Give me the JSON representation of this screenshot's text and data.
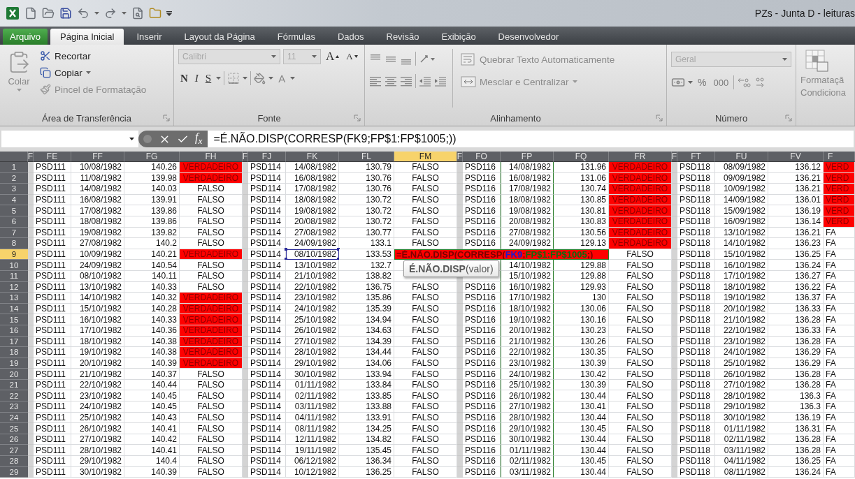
{
  "title_bar": {
    "title": "PZs - Junta D - leituras"
  },
  "ribbon_tabs": [
    {
      "label": "Arquivo",
      "kind": "file",
      "selected": false
    },
    {
      "label": "Página Inicial",
      "kind": "tab",
      "selected": true
    },
    {
      "label": "Inserir",
      "kind": "tab",
      "selected": false
    },
    {
      "label": "Layout da Página",
      "kind": "tab",
      "selected": false
    },
    {
      "label": "Fórmulas",
      "kind": "tab",
      "selected": false
    },
    {
      "label": "Dados",
      "kind": "tab",
      "selected": false
    },
    {
      "label": "Revisão",
      "kind": "tab",
      "selected": false
    },
    {
      "label": "Exibição",
      "kind": "tab",
      "selected": false
    },
    {
      "label": "Desenvolvedor",
      "kind": "tab",
      "selected": false
    }
  ],
  "clipboard": {
    "label": "Área de Transferência",
    "paste": {
      "label": "Colar",
      "disabled": true
    },
    "items": [
      {
        "label": "Recortar",
        "kind": "cut",
        "disabled": false,
        "menu": false
      },
      {
        "label": "Copiar",
        "kind": "copy",
        "disabled": false,
        "menu": true
      },
      {
        "label": "Pincel de Formatação",
        "kind": "painter",
        "disabled": true,
        "menu": false
      }
    ]
  },
  "font": {
    "label": "Fonte",
    "font_name": "Calibri",
    "font_size": "11",
    "grow": "A",
    "shrink": "A",
    "styles": [
      {
        "label": "N",
        "kind": "bold"
      },
      {
        "label": "I",
        "kind": "italic"
      },
      {
        "label": "S",
        "kind": "underline"
      }
    ],
    "font_color": "A"
  },
  "alignment": {
    "label": "Alinhamento",
    "wrap": "Quebrar Texto Automaticamente",
    "merge": "Mesclar e Centralizar"
  },
  "number": {
    "label": "Número",
    "format": "Geral",
    "percent": "%",
    "thousands": "000"
  },
  "styles": {
    "conditional": [
      "Formataçã",
      "Condiciona"
    ]
  },
  "formula_bar": {
    "function": "f$_{x}$",
    "formula": "=É.NÃO.DISP(CORRESP(FK9;FP$1:FP$1005;))"
  },
  "grid": {
    "columns": [
      {
        "label": "F",
        "kind": "gap",
        "selected": false,
        "range_ref": false
      },
      {
        "label": "FE",
        "kind": "code",
        "selected": false,
        "range_ref": false
      },
      {
        "label": "FF",
        "kind": "date",
        "selected": false,
        "range_ref": false
      },
      {
        "label": "FG",
        "kind": "number",
        "selected": false,
        "range_ref": false
      },
      {
        "label": "FH",
        "kind": "flag",
        "selected": false,
        "range_ref": false
      },
      {
        "label": "F",
        "kind": "gap",
        "selected": false,
        "range_ref": false
      },
      {
        "label": "FJ",
        "kind": "code",
        "selected": false,
        "range_ref": false
      },
      {
        "label": "FK",
        "kind": "date",
        "selected": false,
        "range_ref": false
      },
      {
        "label": "FL",
        "kind": "number",
        "selected": false,
        "range_ref": false
      },
      {
        "label": "FM",
        "kind": "flag",
        "selected": true,
        "range_ref": false
      },
      {
        "label": "F",
        "kind": "gap",
        "selected": false,
        "range_ref": false
      },
      {
        "label": "FO",
        "kind": "code",
        "selected": false,
        "range_ref": false
      },
      {
        "label": "FP",
        "kind": "date",
        "selected": false,
        "range_ref": true
      },
      {
        "label": "FQ",
        "kind": "number",
        "selected": false,
        "range_ref": false
      },
      {
        "label": "FR",
        "kind": "flag",
        "selected": false,
        "range_ref": false
      },
      {
        "label": "F",
        "kind": "gap",
        "selected": false,
        "range_ref": false
      },
      {
        "label": "FT",
        "kind": "code",
        "selected": false,
        "range_ref": false
      },
      {
        "label": "FU",
        "kind": "date",
        "selected": false,
        "range_ref": false
      },
      {
        "label": "FV",
        "kind": "number",
        "selected": false,
        "range_ref": false
      },
      {
        "label": "F",
        "kind": "cut",
        "selected": false,
        "range_ref": false
      }
    ],
    "rows": [
      {
        "number": "1",
        "selected": false,
        "cells": [
          "",
          "PSD111",
          "10/08/1982",
          "140.26",
          "VERDADEIRO",
          "",
          "PSD114",
          "14/08/1982",
          "130.79",
          "FALSO",
          "",
          "PSD116",
          "14/08/1982",
          "131.96",
          "VERDADEIRO",
          "",
          "PSD118",
          "08/09/1982",
          "136.12",
          "VERD"
        ],
        "highlighted": [
          true,
          false,
          true,
          true
        ]
      },
      {
        "number": "2",
        "selected": false,
        "cells": [
          "",
          "PSD111",
          "11/08/1982",
          "139.98",
          "VERDADEIRO",
          "",
          "PSD114",
          "16/08/1982",
          "130.76",
          "FALSO",
          "",
          "PSD116",
          "16/08/1982",
          "131.06",
          "VERDADEIRO",
          "",
          "PSD118",
          "09/09/1982",
          "136.21",
          "VERD"
        ],
        "highlighted": [
          true,
          false,
          true,
          true
        ]
      },
      {
        "number": "3",
        "selected": false,
        "cells": [
          "",
          "PSD111",
          "14/08/1982",
          "140.03",
          "FALSO",
          "",
          "PSD114",
          "17/08/1982",
          "130.76",
          "FALSO",
          "",
          "PSD116",
          "17/08/1982",
          "130.74",
          "VERDADEIRO",
          "",
          "PSD118",
          "10/09/1982",
          "136.21",
          "VERD"
        ],
        "highlighted": [
          false,
          false,
          true,
          true
        ]
      },
      {
        "number": "4",
        "selected": false,
        "cells": [
          "",
          "PSD111",
          "16/08/1982",
          "139.91",
          "FALSO",
          "",
          "PSD114",
          "18/08/1982",
          "130.72",
          "FALSO",
          "",
          "PSD116",
          "18/08/1982",
          "130.85",
          "VERDADEIRO",
          "",
          "PSD118",
          "14/09/1982",
          "136.01",
          "VERD"
        ],
        "highlighted": [
          false,
          false,
          true,
          true
        ]
      },
      {
        "number": "5",
        "selected": false,
        "cells": [
          "",
          "PSD111",
          "17/08/1982",
          "139.86",
          "FALSO",
          "",
          "PSD114",
          "19/08/1982",
          "130.72",
          "FALSO",
          "",
          "PSD116",
          "19/08/1982",
          "130.81",
          "VERDADEIRO",
          "",
          "PSD118",
          "15/09/1982",
          "136.19",
          "VERD"
        ],
        "highlighted": [
          false,
          false,
          true,
          true
        ]
      },
      {
        "number": "6",
        "selected": false,
        "cells": [
          "",
          "PSD111",
          "18/08/1982",
          "139.86",
          "FALSO",
          "",
          "PSD114",
          "20/08/1982",
          "130.72",
          "FALSO",
          "",
          "PSD116",
          "20/08/1982",
          "130.83",
          "VERDADEIRO",
          "",
          "PSD118",
          "16/09/1982",
          "136.14",
          "VERD"
        ],
        "highlighted": [
          false,
          false,
          true,
          true
        ]
      },
      {
        "number": "7",
        "selected": false,
        "cells": [
          "",
          "PSD111",
          "19/08/1982",
          "139.82",
          "FALSO",
          "",
          "PSD114",
          "27/08/1982",
          "130.77",
          "FALSO",
          "",
          "PSD116",
          "27/08/1982",
          "130.56",
          "VERDADEIRO",
          "",
          "PSD118",
          "13/10/1982",
          "136.21",
          "FA"
        ],
        "highlighted": [
          false,
          false,
          true,
          false
        ]
      },
      {
        "number": "8",
        "selected": false,
        "cells": [
          "",
          "PSD111",
          "27/08/1982",
          "140.2",
          "FALSO",
          "",
          "PSD114",
          "24/09/1982",
          "133.1",
          "FALSO",
          "",
          "PSD116",
          "24/09/1982",
          "129.13",
          "VERDADEIRO",
          "",
          "PSD118",
          "14/10/1982",
          "136.23",
          "FA"
        ],
        "highlighted": [
          false,
          false,
          true,
          false
        ]
      },
      {
        "number": "9",
        "selected": true,
        "cells": [
          "",
          "PSD111",
          "10/09/1982",
          "140.21",
          "VERDADEIRO",
          "",
          "PSD114",
          {
            "text": "08/10/1982",
            "referenced": true
          },
          "133.53",
          null,
          null,
          null,
          null,
          null,
          "FALSO",
          "",
          "PSD118",
          "15/10/1982",
          "136.25",
          "FA"
        ],
        "highlighted": [
          true,
          true,
          false,
          false
        ],
        "formula": [
          {
            "text": "=É.NÃO.DISP(CORRESP(",
            "kind": "text"
          },
          {
            "text": "FK9",
            "kind": "cell_ref"
          },
          {
            "text": ";",
            "kind": "text"
          },
          {
            "text": "FP$1:FP$1005",
            "kind": "range_ref"
          },
          {
            "text": ";)",
            "kind": "text"
          }
        ]
      },
      {
        "number": "10",
        "selected": false,
        "cells": [
          "",
          "PSD111",
          "24/09/1982",
          "140.54",
          "FALSO",
          "",
          "PSD114",
          "13/10/1982",
          "132.7",
          null,
          "",
          null,
          "14/10/1982",
          "129.88",
          "FALSO",
          "",
          "PSD118",
          "16/10/1982",
          "136.24",
          "FA"
        ],
        "highlighted": [
          false,
          false,
          false,
          false
        ]
      },
      {
        "number": "11",
        "selected": false,
        "cells": [
          "",
          "PSD111",
          "08/10/1982",
          "140.11",
          "FALSO",
          "",
          "PSD114",
          "21/10/1982",
          "138.82",
          null,
          "",
          null,
          "15/10/1982",
          "129.88",
          "FALSO",
          "",
          "PSD118",
          "17/10/1982",
          "136.27",
          "FA"
        ],
        "highlighted": [
          false,
          false,
          false,
          false
        ]
      },
      {
        "number": "12",
        "selected": false,
        "cells": [
          "",
          "PSD111",
          "13/10/1982",
          "140.33",
          "FALSO",
          "",
          "PSD114",
          "22/10/1982",
          "136.75",
          "FALSO",
          "",
          "PSD116",
          "16/10/1982",
          "129.93",
          "FALSO",
          "",
          "PSD118",
          "18/10/1982",
          "136.22",
          "FA"
        ],
        "highlighted": [
          false,
          false,
          false,
          false
        ]
      },
      {
        "number": "13",
        "selected": false,
        "cells": [
          "",
          "PSD111",
          "14/10/1982",
          "140.32",
          "VERDADEIRO",
          "",
          "PSD114",
          "23/10/1982",
          "135.86",
          "FALSO",
          "",
          "PSD116",
          "17/10/1982",
          "130",
          "FALSO",
          "",
          "PSD118",
          "19/10/1982",
          "136.37",
          "FA"
        ],
        "highlighted": [
          true,
          false,
          false,
          false
        ]
      },
      {
        "number": "14",
        "selected": false,
        "cells": [
          "",
          "PSD111",
          "15/10/1982",
          "140.28",
          "VERDADEIRO",
          "",
          "PSD114",
          "24/10/1982",
          "135.39",
          "FALSO",
          "",
          "PSD116",
          "18/10/1982",
          "130.06",
          "FALSO",
          "",
          "PSD118",
          "20/10/1982",
          "136.33",
          "FA"
        ],
        "highlighted": [
          true,
          false,
          false,
          false
        ]
      },
      {
        "number": "15",
        "selected": false,
        "cells": [
          "",
          "PSD111",
          "16/10/1982",
          "140.33",
          "VERDADEIRO",
          "",
          "PSD114",
          "25/10/1982",
          "134.94",
          "FALSO",
          "",
          "PSD116",
          "19/10/1982",
          "130.16",
          "FALSO",
          "",
          "PSD118",
          "21/10/1982",
          "136.28",
          "FA"
        ],
        "highlighted": [
          true,
          false,
          false,
          false
        ]
      },
      {
        "number": "16",
        "selected": false,
        "cells": [
          "",
          "PSD111",
          "17/10/1982",
          "140.36",
          "VERDADEIRO",
          "",
          "PSD114",
          "26/10/1982",
          "134.63",
          "FALSO",
          "",
          "PSD116",
          "20/10/1982",
          "130.23",
          "FALSO",
          "",
          "PSD118",
          "22/10/1982",
          "136.33",
          "FA"
        ],
        "highlighted": [
          true,
          false,
          false,
          false
        ]
      },
      {
        "number": "17",
        "selected": false,
        "cells": [
          "",
          "PSD111",
          "18/10/1982",
          "140.38",
          "VERDADEIRO",
          "",
          "PSD114",
          "27/10/1982",
          "134.39",
          "FALSO",
          "",
          "PSD116",
          "21/10/1982",
          "130.26",
          "FALSO",
          "",
          "PSD118",
          "23/10/1982",
          "136.28",
          "FA"
        ],
        "highlighted": [
          true,
          false,
          false,
          false
        ]
      },
      {
        "number": "18",
        "selected": false,
        "cells": [
          "",
          "PSD111",
          "19/10/1982",
          "140.38",
          "VERDADEIRO",
          "",
          "PSD114",
          "28/10/1982",
          "134.44",
          "FALSO",
          "",
          "PSD116",
          "22/10/1982",
          "130.35",
          "FALSO",
          "",
          "PSD118",
          "24/10/1982",
          "136.29",
          "FA"
        ],
        "highlighted": [
          true,
          false,
          false,
          false
        ]
      },
      {
        "number": "19",
        "selected": false,
        "cells": [
          "",
          "PSD111",
          "20/10/1982",
          "140.39",
          "VERDADEIRO",
          "",
          "PSD114",
          "29/10/1982",
          "134.06",
          "FALSO",
          "",
          "PSD116",
          "23/10/1982",
          "130.39",
          "FALSO",
          "",
          "PSD118",
          "25/10/1982",
          "136.29",
          "FA"
        ],
        "highlighted": [
          true,
          false,
          false,
          false
        ]
      },
      {
        "number": "20",
        "selected": false,
        "cells": [
          "",
          "PSD111",
          "21/10/1982",
          "140.37",
          "FALSO",
          "",
          "PSD114",
          "30/10/1982",
          "133.94",
          "FALSO",
          "",
          "PSD116",
          "24/10/1982",
          "130.42",
          "FALSO",
          "",
          "PSD118",
          "26/10/1982",
          "136.28",
          "FA"
        ],
        "highlighted": [
          false,
          false,
          false,
          false
        ]
      },
      {
        "number": "21",
        "selected": false,
        "cells": [
          "",
          "PSD111",
          "22/10/1982",
          "140.44",
          "FALSO",
          "",
          "PSD114",
          "01/11/1982",
          "133.84",
          "FALSO",
          "",
          "PSD116",
          "25/10/1982",
          "130.39",
          "FALSO",
          "",
          "PSD118",
          "27/10/1982",
          "136.28",
          "FA"
        ],
        "highlighted": [
          false,
          false,
          false,
          false
        ]
      },
      {
        "number": "22",
        "selected": false,
        "cells": [
          "",
          "PSD111",
          "23/10/1982",
          "140.45",
          "FALSO",
          "",
          "PSD114",
          "02/11/1982",
          "133.85",
          "FALSO",
          "",
          "PSD116",
          "26/10/1982",
          "130.44",
          "FALSO",
          "",
          "PSD118",
          "28/10/1982",
          "136.3",
          "FA"
        ],
        "highlighted": [
          false,
          false,
          false,
          false
        ]
      },
      {
        "number": "23",
        "selected": false,
        "cells": [
          "",
          "PSD111",
          "24/10/1982",
          "140.45",
          "FALSO",
          "",
          "PSD114",
          "03/11/1982",
          "133.88",
          "FALSO",
          "",
          "PSD116",
          "27/10/1982",
          "130.41",
          "FALSO",
          "",
          "PSD118",
          "29/10/1982",
          "136.3",
          "FA"
        ],
        "highlighted": [
          false,
          false,
          false,
          false
        ]
      },
      {
        "number": "24",
        "selected": false,
        "cells": [
          "",
          "PSD111",
          "25/10/1982",
          "140.43",
          "FALSO",
          "",
          "PSD114",
          "04/11/1982",
          "133.91",
          "FALSO",
          "",
          "PSD116",
          "28/10/1982",
          "130.44",
          "FALSO",
          "",
          "PSD118",
          "30/10/1982",
          "136.19",
          "FA"
        ],
        "highlighted": [
          false,
          false,
          false,
          false
        ]
      },
      {
        "number": "25",
        "selected": false,
        "cells": [
          "",
          "PSD111",
          "26/10/1982",
          "140.41",
          "FALSO",
          "",
          "PSD114",
          "08/11/1982",
          "134.25",
          "FALSO",
          "",
          "PSD116",
          "29/10/1982",
          "130.45",
          "FALSO",
          "",
          "PSD118",
          "01/11/1982",
          "136.31",
          "FA"
        ],
        "highlighted": [
          false,
          false,
          false,
          false
        ]
      },
      {
        "number": "26",
        "selected": false,
        "cells": [
          "",
          "PSD111",
          "27/10/1982",
          "140.42",
          "FALSO",
          "",
          "PSD114",
          "12/11/1982",
          "134.82",
          "FALSO",
          "",
          "PSD116",
          "30/10/1982",
          "130.44",
          "FALSO",
          "",
          "PSD118",
          "02/11/1982",
          "136.28",
          "FA"
        ],
        "highlighted": [
          false,
          false,
          false,
          false
        ]
      },
      {
        "number": "27",
        "selected": false,
        "cells": [
          "",
          "PSD111",
          "28/10/1982",
          "140.41",
          "FALSO",
          "",
          "PSD114",
          "19/11/1982",
          "135.45",
          "FALSO",
          "",
          "PSD116",
          "01/11/1982",
          "130.44",
          "FALSO",
          "",
          "PSD118",
          "03/11/1982",
          "136.28",
          "FA"
        ],
        "highlighted": [
          false,
          false,
          false,
          false
        ]
      },
      {
        "number": "28",
        "selected": false,
        "cells": [
          "",
          "PSD111",
          "29/10/1982",
          "140.4",
          "FALSO",
          "",
          "PSD114",
          "06/12/1982",
          "136.34",
          "FALSO",
          "",
          "PSD116",
          "02/11/1982",
          "130.45",
          "FALSO",
          "",
          "PSD118",
          "04/11/1982",
          "136.25",
          "FA"
        ],
        "highlighted": [
          false,
          false,
          false,
          false
        ]
      },
      {
        "number": "29",
        "selected": false,
        "cells": [
          "",
          "PSD111",
          "30/10/1982",
          "140.39",
          "FALSO",
          "",
          "PSD114",
          "10/12/1982",
          "136.25",
          "FALSO",
          "",
          "PSD116",
          "03/11/1982",
          "130.44",
          "FALSO",
          "",
          "PSD118",
          "08/11/1982",
          "136.24",
          "FA"
        ],
        "highlighted": [
          false,
          false,
          false,
          false
        ]
      }
    ],
    "tooltip": "**É.NÃO.DISP**(valor)"
  }
}
